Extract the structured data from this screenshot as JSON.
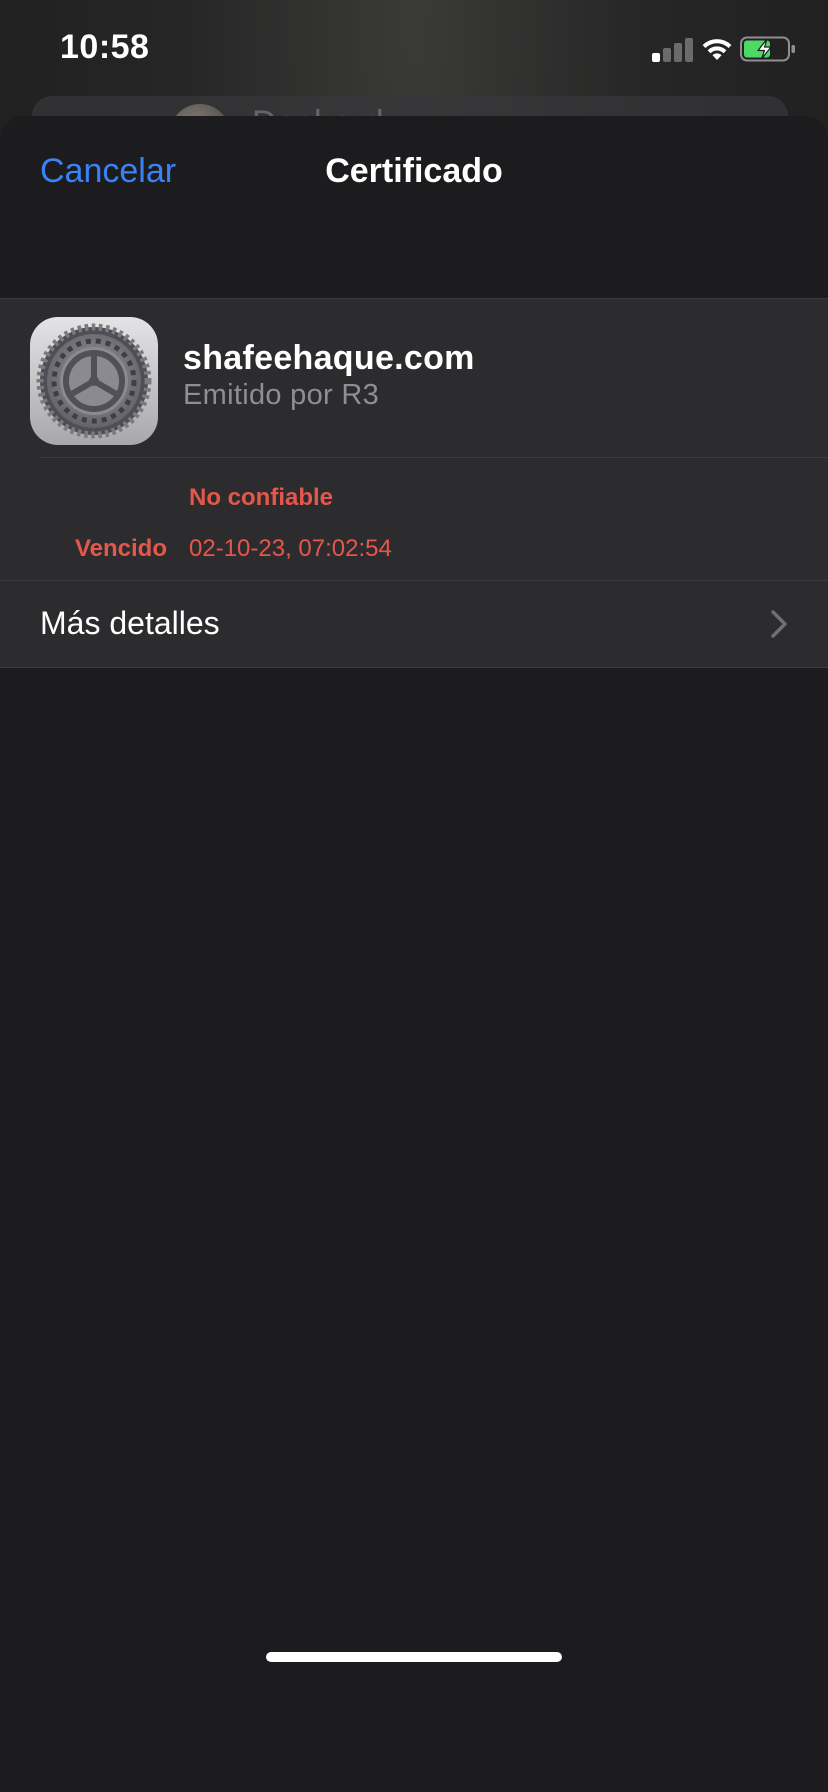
{
  "status_bar": {
    "time": "10:58",
    "signal_bars_active": 1,
    "signal_bars_total": 4,
    "battery_charging": true,
    "battery_color": "#4cd964"
  },
  "background": {
    "peek_text": "Desbord..."
  },
  "nav": {
    "cancel_label": "Cancelar",
    "title": "Certificado"
  },
  "certificate": {
    "icon": "settings-gear-icon",
    "domain": "shafeehaque.com",
    "issuer": "Emitido por R3",
    "trust_status": "No confiable",
    "expires_label": "Vencido",
    "expires_value": "02-10-23, 07:02:54"
  },
  "more_details": {
    "label": "Más detalles",
    "icon": "chevron-right-icon"
  },
  "colors": {
    "accent": "#3a82f7",
    "danger": "#e5574a",
    "sheet_bg": "#1c1c1e",
    "group_bg": "#2c2c2e"
  }
}
